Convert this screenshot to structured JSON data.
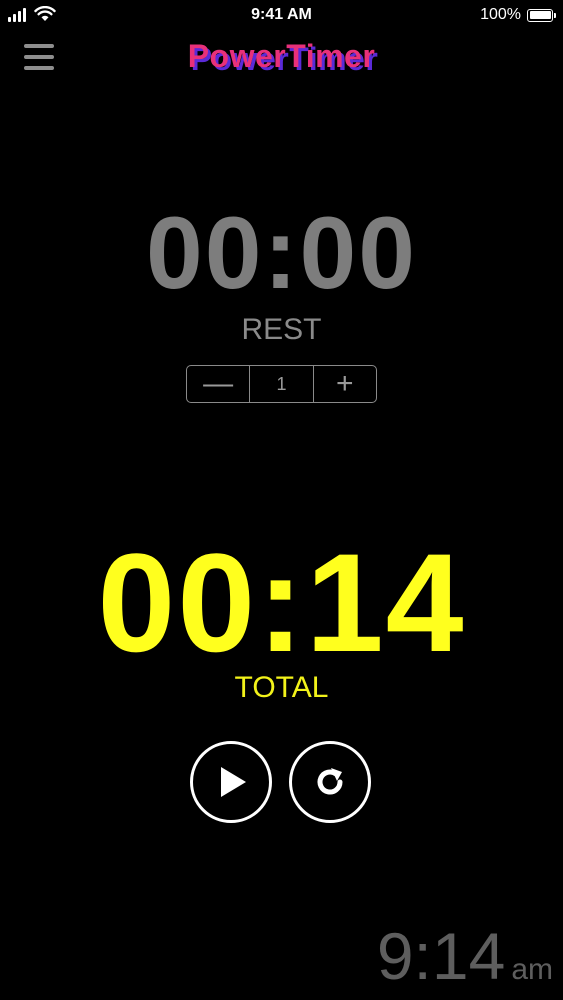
{
  "status_bar": {
    "time": "9:41 AM",
    "battery": "100%"
  },
  "header": {
    "app_title": "PowerTimer",
    "menu_icon": "hamburger-menu-icon"
  },
  "rest": {
    "time": "00:00",
    "label": "REST",
    "stepper": {
      "minus": "—",
      "value": "1",
      "plus": "+"
    }
  },
  "total": {
    "time": "00:14",
    "label": "TOTAL"
  },
  "controls": {
    "play_icon": "play-icon",
    "reset_icon": "reset-icon"
  },
  "clock": {
    "time": "9:14",
    "ampm": "am"
  },
  "colors": {
    "background": "#000000",
    "total_accent": "#ffff1e",
    "rest_gray": "#7d7d7d",
    "title_pink": "#e8307a",
    "title_shadow": "#5a2ad8"
  }
}
